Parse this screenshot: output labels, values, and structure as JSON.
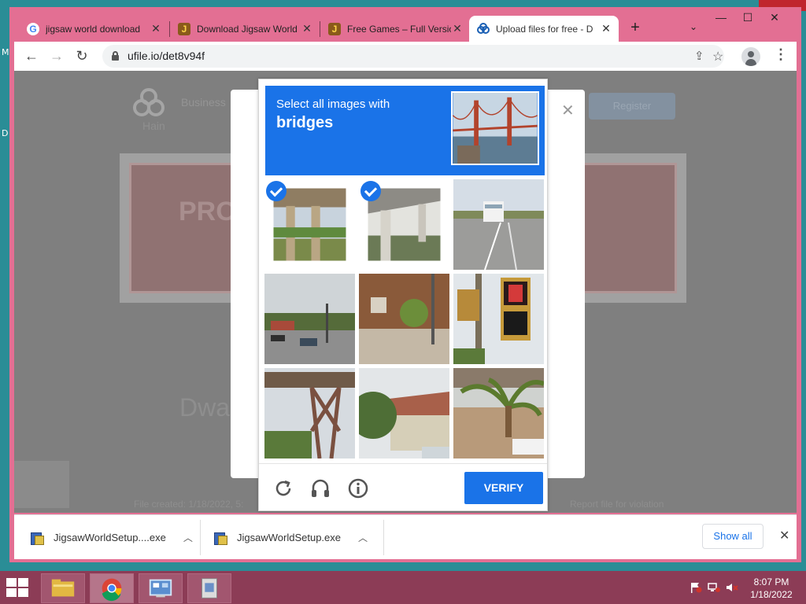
{
  "desktop": {
    "edge_letter_1": "M",
    "edge_letter_2": "D"
  },
  "browser": {
    "tabs": [
      {
        "title": "jigsaw world download",
        "icon": "google-g-icon"
      },
      {
        "title": "Download Jigsaw World",
        "icon": "jigsaw-site-icon"
      },
      {
        "title": "Free Games – Full Version",
        "icon": "jigsaw-site-icon"
      },
      {
        "title": "Upload files for free - D",
        "icon": "ufile-logo-icon",
        "active": true
      }
    ],
    "new_tab_label": "+",
    "tab_search_label": "⌄",
    "window_buttons": {
      "minimize": "—",
      "maximize": "☐",
      "close": "✕"
    },
    "url": "ufile.io/det8v94f"
  },
  "page": {
    "logo_text": "Hain",
    "nav_text": "Business",
    "register_label": "Register",
    "banner_text": "PRO AW",
    "filename_text": "Dwa                                    rsd",
    "footer_left": "File created: 1/18/2022, 5:",
    "footer_right": "Report file for violation",
    "modal_close": "✕"
  },
  "captcha": {
    "instruction": "Select all images with",
    "target": "bridges",
    "tiles": [
      {
        "subject": "overpass-pillar",
        "selected": true
      },
      {
        "subject": "overpass-pillar",
        "selected": true
      },
      {
        "subject": "highway-with-rv",
        "selected": false
      },
      {
        "subject": "street-intersection",
        "selected": false
      },
      {
        "subject": "house-with-garden",
        "selected": false
      },
      {
        "subject": "pedestrian-signal",
        "selected": false
      },
      {
        "subject": "railway-bridge",
        "selected": false
      },
      {
        "subject": "house-with-tree",
        "selected": false
      },
      {
        "subject": "palm-tree-yard",
        "selected": false
      }
    ],
    "verify_label": "VERIFY",
    "icons": [
      "reload-icon",
      "headphones-icon",
      "info-icon"
    ],
    "colors": {
      "accent": "#1a73e8"
    }
  },
  "downloads": {
    "items": [
      {
        "filename": "JigsawWorldSetup....exe"
      },
      {
        "filename": "JigsawWorldSetup.exe"
      }
    ],
    "show_all_label": "Show all",
    "close_label": "✕"
  },
  "taskbar": {
    "time": "8:07 PM",
    "date": "1/18/2022",
    "apps": [
      "file-explorer-icon",
      "chrome-icon",
      "control-panel-icon",
      "installer-icon"
    ]
  }
}
